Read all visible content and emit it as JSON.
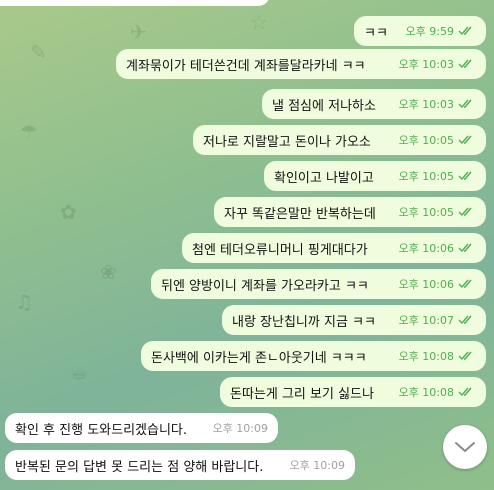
{
  "outgoing": [
    {
      "text": "ㅋㅋ",
      "time": "오후 9:59"
    },
    {
      "text": "계좌묶이가 테더쓴건데 계좌를달라카네 ㅋㅋ",
      "time": "오후 10:03"
    },
    {
      "text": "낼 점심에 저나하소",
      "time": "오후 10:03"
    },
    {
      "text": "저나로 지랄말고 돈이나 가오소",
      "time": "오후 10:05"
    },
    {
      "text": "확인이고 나발이고",
      "time": "오후 10:05"
    },
    {
      "text": "자꾸 똑같은말만 반복하는데",
      "time": "오후 10:05"
    },
    {
      "text": "첨엔 테더오류니머니 핑게대다가",
      "time": "오후 10:06"
    },
    {
      "text": "뒤엔 양방이니 계좌를 가오라카고 ㅋㅋ",
      "time": "오후 10:06"
    },
    {
      "text": "내랑 장난칩니까 지금 ㅋㅋ",
      "time": "오후 10:07"
    },
    {
      "text": "돈사백에 이카는게 존ㄴ아웃기네 ㅋㅋㅋ",
      "time": "오후 10:08"
    },
    {
      "text": "돈따는게 그리 보기 싫드나",
      "time": "오후 10:08"
    }
  ],
  "incoming": [
    {
      "text": "확인 후 진행 도와드리겠습니다.",
      "time": "오후 10:09"
    },
    {
      "text": "반복된 문의 답변 못 드리는 점 양해 바랍니다.",
      "time": "오후 10:09"
    }
  ],
  "colors": {
    "outgoing_bubble": "#effdde",
    "incoming_bubble": "#ffffff",
    "read_check": "#4fae4e"
  },
  "icons": {
    "read_receipt": "double-check-icon",
    "scroll_down": "chevron-down-icon"
  }
}
